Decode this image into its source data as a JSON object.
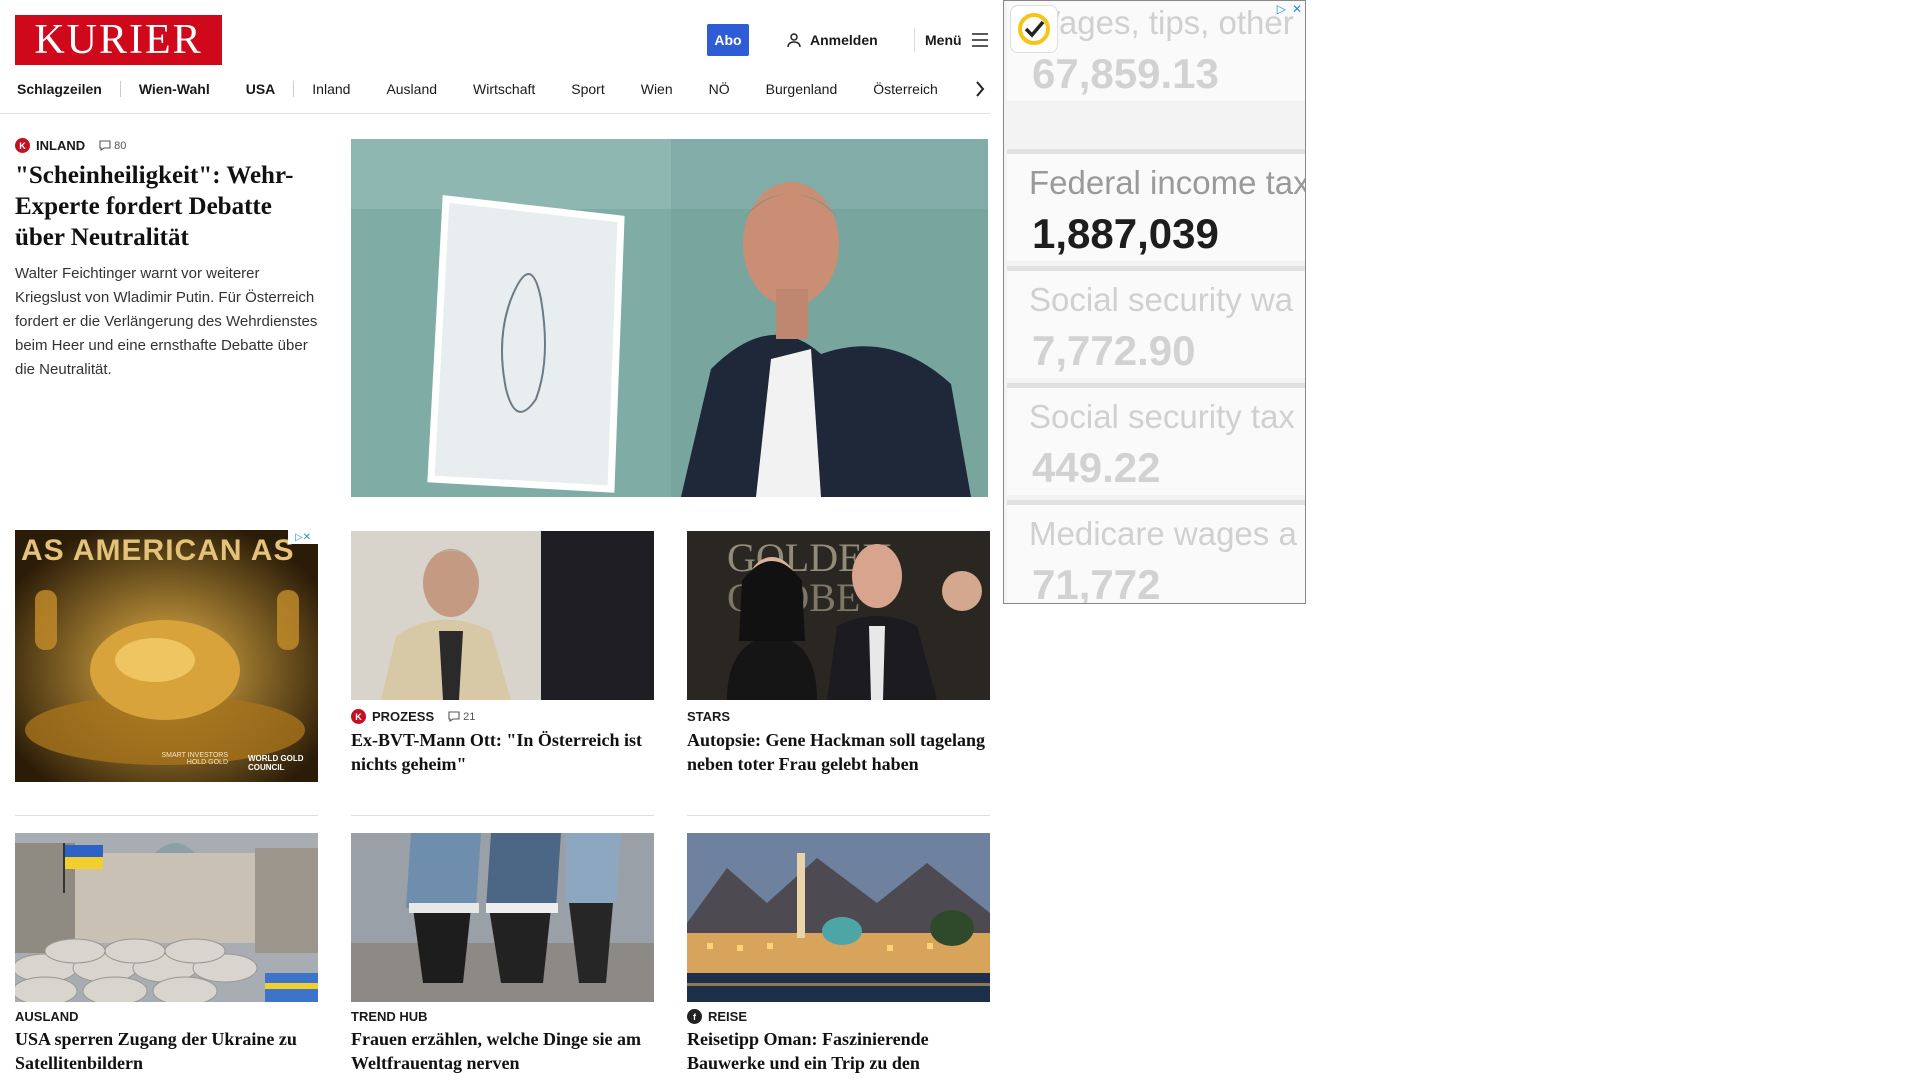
{
  "header": {
    "logo": "KURIER",
    "abo": "Abo",
    "login": "Anmelden",
    "menu": "Menü"
  },
  "nav": {
    "items": [
      "Schlagzeilen",
      "Wien-Wahl",
      "USA",
      "Inland",
      "Ausland",
      "Wirtschaft",
      "Sport",
      "Wien",
      "NÖ",
      "Burgenland",
      "Österreich"
    ]
  },
  "lead": {
    "kicker": "INLAND",
    "comments": "80",
    "title": "\"Scheinheiligkeit\": Wehr-Experte fordert Debatte über Neutralität",
    "text": "Walter Feichtinger warnt vor weiterer Kriegslust von Wladimir Putin. Für Österreich fordert er die Verlängerung des Wehrdienstes beim Heer und eine ernsthafte Debatte über die Neutralität."
  },
  "ad_small": {
    "headline": "AS AMERICAN AS",
    "tagline": "SMART INVESTORS HOLD GOLD",
    "brand": "WORLD GOLD COUNCIL"
  },
  "cards": [
    {
      "kicker": "PROZESS",
      "comments": "21",
      "title": "Ex-BVT-Mann Ott: \"In Österreich ist nichts geheim\""
    },
    {
      "kicker": "STARS",
      "comments": "",
      "title": "Autopsie: Gene Hackman soll tagelang neben toter Frau gelebt haben"
    },
    {
      "kicker": "AUSLAND",
      "comments": "",
      "title": "USA sperren Zugang der Ukraine zu Satellitenbildern"
    },
    {
      "kicker": "TREND HUB",
      "comments": "",
      "title": "Frauen erzählen, welche Dinge sie am Weltfrauentag nerven"
    },
    {
      "kicker": "REISE",
      "comments": "",
      "title": "Reisetipp Oman: Faszinierende Bauwerke und ein Trip zu den Beduinen"
    }
  ],
  "side_ad": {
    "rows": [
      {
        "label": "Wages, tips, other",
        "value": "67,859.13"
      },
      {
        "label": "Federal income tax",
        "value": "1,887,039"
      },
      {
        "label": "Social security wa",
        "value": "7,772.90"
      },
      {
        "label": "Social security tax",
        "value": "449.22"
      },
      {
        "label": "Medicare wages a",
        "value": "71,772"
      }
    ]
  },
  "colors": {
    "brand": "#d0081c",
    "abo": "#2e5bd6"
  }
}
